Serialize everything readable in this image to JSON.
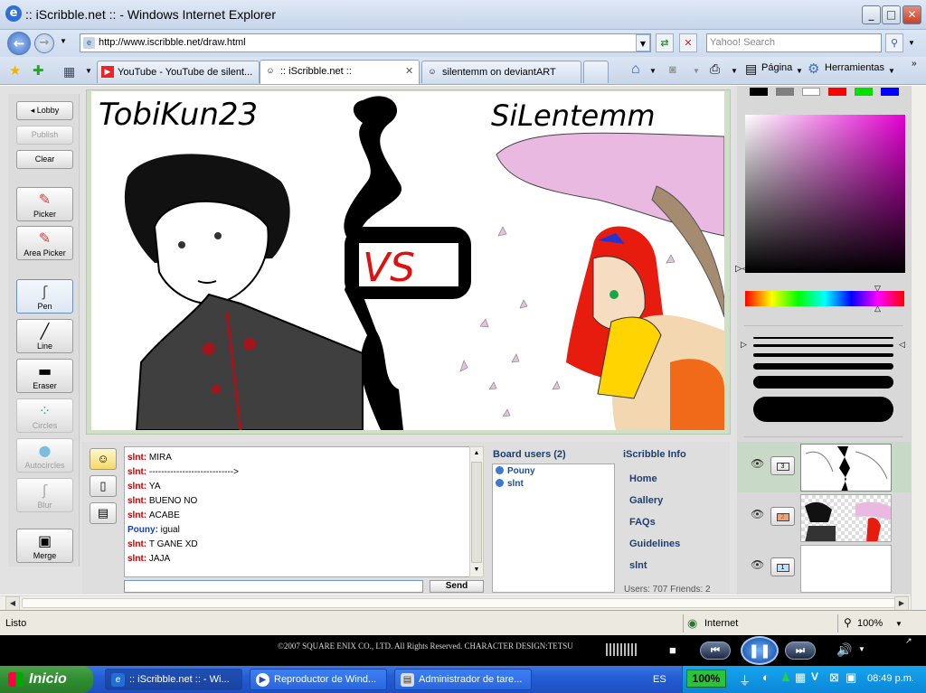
{
  "window": {
    "title": ":: iScribble.net :: - Windows Internet Explorer"
  },
  "address": {
    "url": "http://www.iscribble.net/draw.html",
    "search_placeholder": "Yahoo! Search"
  },
  "tabs": [
    {
      "label": "YouTube - YouTube de silent..."
    },
    {
      "label": ":: iScribble.net ::"
    },
    {
      "label": "silentemm on deviantART"
    }
  ],
  "toolbar": {
    "page_label": "Página",
    "tools_label": "Herramientas"
  },
  "tools": {
    "lobby": "◂ Lobby",
    "publish": "Publish",
    "clear": "Clear",
    "picker": "Picker",
    "area_picker": "Area Picker",
    "pen": "Pen",
    "line": "Line",
    "eraser": "Eraser",
    "circles": "Circles",
    "autocircles": "Autocircles",
    "blur": "Blur",
    "merge": "Merge"
  },
  "drawing": {
    "left_name": "TobiKun23",
    "vs": "VS",
    "right_name": "SiLentemm"
  },
  "palette": {
    "swatches": [
      "#000000",
      "#7f7f7f",
      "#ffffff",
      "#ff0000",
      "#00e000",
      "#0000ff"
    ]
  },
  "layers": [
    {
      "num": "3"
    },
    {
      "num": "2"
    },
    {
      "num": "1"
    }
  ],
  "chat": {
    "messages": [
      {
        "user": "slnt",
        "text": "MIRA",
        "color": "#c00000"
      },
      {
        "user": "slnt",
        "text": "---------------------------->",
        "color": "#c00000"
      },
      {
        "user": "slnt",
        "text": "YA",
        "color": "#c00000"
      },
      {
        "user": "slnt",
        "text": "BUENO NO",
        "color": "#c00000"
      },
      {
        "user": "slnt",
        "text": "ACABE",
        "color": "#c00000"
      },
      {
        "user": "Pouny",
        "text": "igual",
        "color": "#1c3fb0"
      },
      {
        "user": "slnt",
        "text": "T GANE XD",
        "color": "#c00000"
      },
      {
        "user": "slnt",
        "text": "JAJA",
        "color": "#c00000"
      }
    ],
    "send_label": "Send"
  },
  "board_users": {
    "title": "Board users (2)",
    "users": [
      "Pouny",
      "slnt"
    ]
  },
  "info": {
    "title": "iScribble Info",
    "links": [
      "Home",
      "Gallery",
      "FAQs",
      "Guidelines",
      "slnt"
    ],
    "partial": "Users: 707 Friends: 2"
  },
  "status": {
    "text": "Listo",
    "zone": "Internet",
    "zoom": "100%"
  },
  "media": {
    "footer": "©2007 SQUARE ENIX CO., LTD. All Rights Reserved. CHARACTER DESIGN:TETSU"
  },
  "taskbar": {
    "start": "Inicio",
    "tasks": [
      ":: iScribble.net :: - Wi...",
      "Reproductor de Wind...",
      "Administrador de tare..."
    ],
    "lang": "ES",
    "battery": "100%",
    "clock": "08:49 p.m."
  }
}
